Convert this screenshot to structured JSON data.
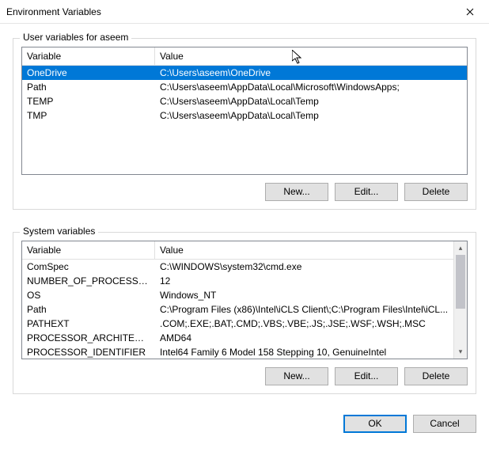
{
  "title": "Environment Variables",
  "user_group": {
    "legend": "User variables for aseem",
    "columns": {
      "var": "Variable",
      "val": "Value"
    },
    "rows": [
      {
        "var": "OneDrive",
        "val": "C:\\Users\\aseem\\OneDrive",
        "selected": true
      },
      {
        "var": "Path",
        "val": "C:\\Users\\aseem\\AppData\\Local\\Microsoft\\WindowsApps;"
      },
      {
        "var": "TEMP",
        "val": "C:\\Users\\aseem\\AppData\\Local\\Temp"
      },
      {
        "var": "TMP",
        "val": "C:\\Users\\aseem\\AppData\\Local\\Temp"
      }
    ],
    "buttons": {
      "new": "New...",
      "edit": "Edit...",
      "del": "Delete"
    },
    "has_scrollbar": false
  },
  "system_group": {
    "legend": "System variables",
    "columns": {
      "var": "Variable",
      "val": "Value"
    },
    "rows": [
      {
        "var": "ComSpec",
        "val": "C:\\WINDOWS\\system32\\cmd.exe"
      },
      {
        "var": "NUMBER_OF_PROCESSORS",
        "val": "12"
      },
      {
        "var": "OS",
        "val": "Windows_NT"
      },
      {
        "var": "Path",
        "val": "C:\\Program Files (x86)\\Intel\\iCLS Client\\;C:\\Program Files\\Intel\\iCL..."
      },
      {
        "var": "PATHEXT",
        "val": ".COM;.EXE;.BAT;.CMD;.VBS;.VBE;.JS;.JSE;.WSF;.WSH;.MSC"
      },
      {
        "var": "PROCESSOR_ARCHITECTURE",
        "val": "AMD64"
      },
      {
        "var": "PROCESSOR_IDENTIFIER",
        "val": "Intel64 Family 6 Model 158 Stepping 10, GenuineIntel"
      }
    ],
    "buttons": {
      "new": "New...",
      "edit": "Edit...",
      "del": "Delete"
    },
    "has_scrollbar": true
  },
  "footer": {
    "ok": "OK",
    "cancel": "Cancel"
  }
}
